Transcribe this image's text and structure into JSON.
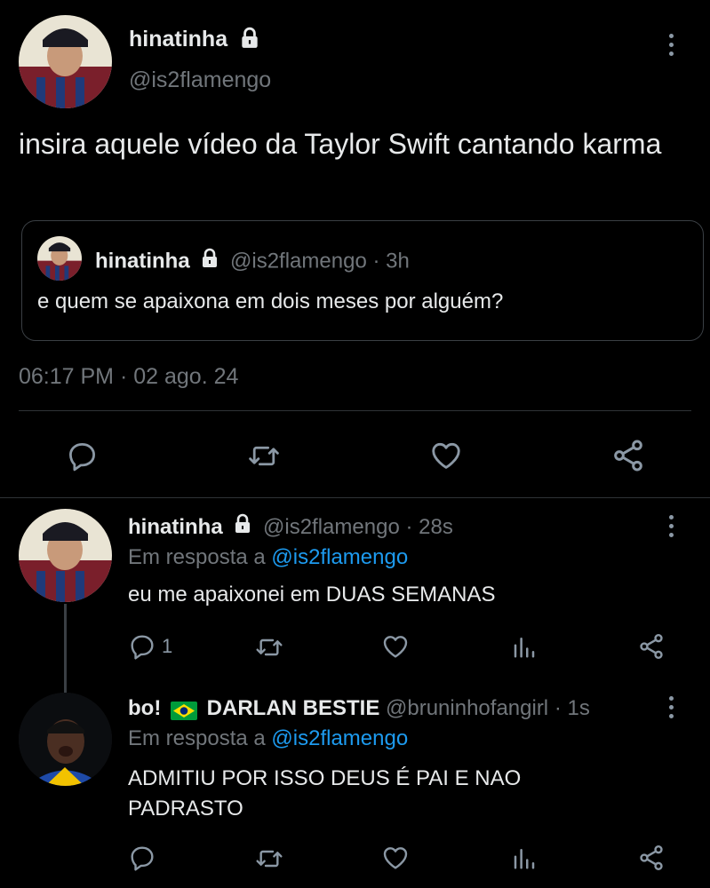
{
  "main_tweet": {
    "display_name": "hinatinha",
    "handle": "@is2flamengo",
    "text": "insira aquele vídeo da Taylor Swift cantando karma",
    "timestamp": "06:17 PM · 02 ago. 24",
    "quoted": {
      "display_name": "hinatinha",
      "handle": "@is2flamengo",
      "separator": "·",
      "time": "3h",
      "text": "e quem se apaixona em dois meses por alguém?"
    },
    "actions": [
      "reply-icon",
      "retweet-icon",
      "like-icon",
      "share-icon"
    ]
  },
  "replies": [
    {
      "display_name": "hinatinha",
      "handle": "@is2flamengo",
      "separator": "·",
      "time": "28s",
      "reply_prefix": "Em resposta a",
      "reply_to": "@is2flamengo",
      "text": "eu me apaixonei em DUAS SEMANAS",
      "reply_count": "1"
    },
    {
      "display_name_prefix": "bo!",
      "flag": "🇧🇷",
      "display_name": "DARLAN BESTIE",
      "handle": "@bruninhofangirl",
      "separator": "·",
      "time": "1s",
      "reply_prefix": "Em resposta a",
      "reply_to": "@is2flamengo",
      "text": "ADMITIU POR ISSO DEUS É PAI E NAO PADRASTO"
    }
  ],
  "colors": {
    "background": "#000000",
    "text": "#e7e9ea",
    "muted": "#71767b",
    "link": "#1d9bf0",
    "divider": "#2f3336"
  }
}
